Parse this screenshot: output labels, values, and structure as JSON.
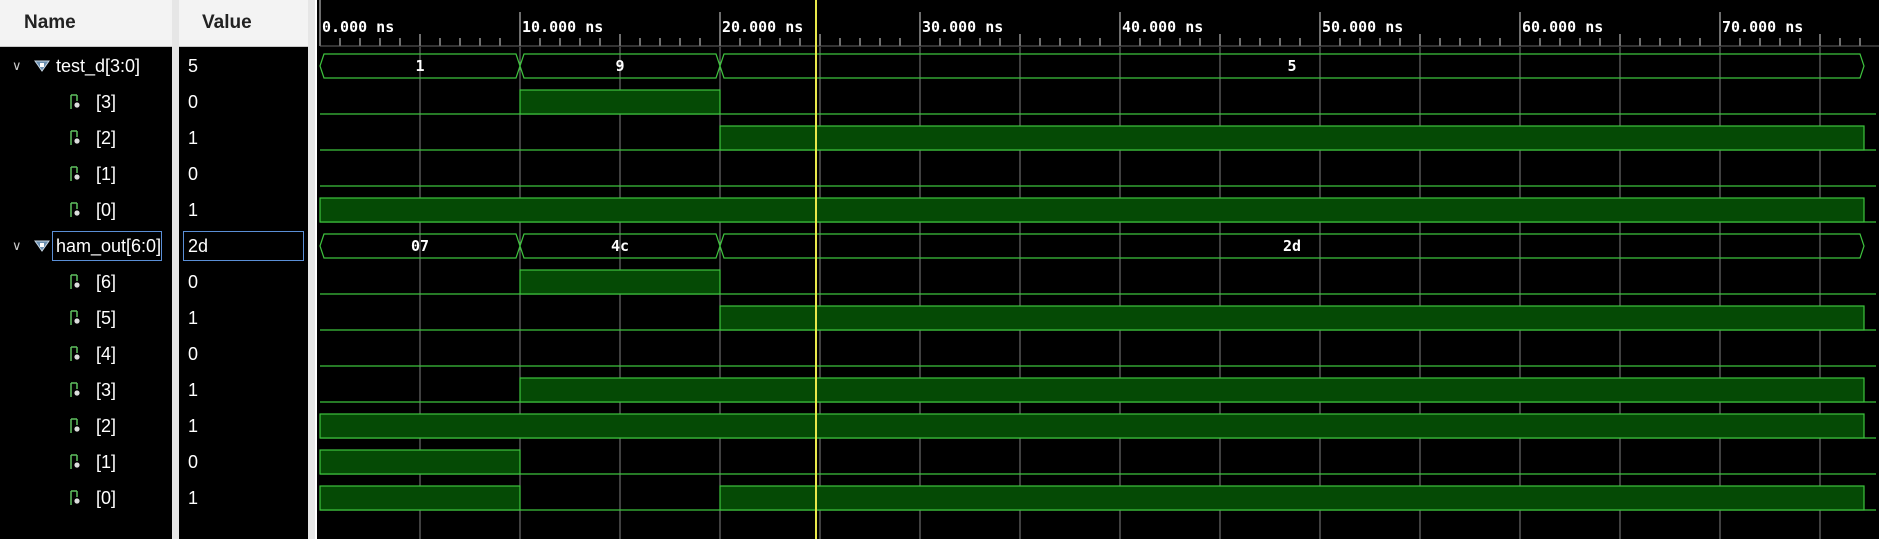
{
  "header": {
    "name_label": "Name",
    "value_label": "Value"
  },
  "timeline": {
    "start_ns": 0,
    "end_ns": 77.2,
    "unit": " ns",
    "tick_labels": [
      "0.000 ns",
      "10.000 ns",
      "20.000 ns",
      "30.000 ns",
      "40.000 ns",
      "50.000 ns",
      "60.000 ns",
      "70.000 ns"
    ],
    "cursor_ns": 24.8
  },
  "colors": {
    "high_fill": "#054a05",
    "line": "#3ec43e",
    "cursor": "#e8e84a",
    "grid": "#a0a0a0"
  },
  "signals": [
    {
      "kind": "bus",
      "name": "test_d[3:0]",
      "value": "5",
      "segments": [
        {
          "t0": 0,
          "t1": 10,
          "label": "1"
        },
        {
          "t0": 10,
          "t1": 20,
          "label": "9"
        },
        {
          "t0": 20,
          "t1": 77.2,
          "label": "5"
        }
      ]
    },
    {
      "kind": "bit",
      "name": "[3]",
      "value": "0",
      "high": [
        [
          10,
          20
        ]
      ]
    },
    {
      "kind": "bit",
      "name": "[2]",
      "value": "1",
      "high": [
        [
          20,
          77.2
        ]
      ]
    },
    {
      "kind": "bit",
      "name": "[1]",
      "value": "0",
      "high": []
    },
    {
      "kind": "bit",
      "name": "[0]",
      "value": "1",
      "high": [
        [
          0,
          77.2
        ]
      ]
    },
    {
      "kind": "bus",
      "name": "ham_out[6:0]",
      "value": "2d",
      "selected": true,
      "segments": [
        {
          "t0": 0,
          "t1": 10,
          "label": "07"
        },
        {
          "t0": 10,
          "t1": 20,
          "label": "4c"
        },
        {
          "t0": 20,
          "t1": 77.2,
          "label": "2d"
        }
      ]
    },
    {
      "kind": "bit",
      "name": "[6]",
      "value": "0",
      "high": [
        [
          10,
          20
        ]
      ]
    },
    {
      "kind": "bit",
      "name": "[5]",
      "value": "1",
      "high": [
        [
          20,
          77.2
        ]
      ]
    },
    {
      "kind": "bit",
      "name": "[4]",
      "value": "0",
      "high": []
    },
    {
      "kind": "bit",
      "name": "[3]",
      "value": "1",
      "high": [
        [
          10,
          77.2
        ]
      ]
    },
    {
      "kind": "bit",
      "name": "[2]",
      "value": "1",
      "high": [
        [
          0,
          77.2
        ]
      ]
    },
    {
      "kind": "bit",
      "name": "[1]",
      "value": "0",
      "high": [
        [
          0,
          10
        ]
      ]
    },
    {
      "kind": "bit",
      "name": "[0]",
      "value": "1",
      "high": [
        [
          0,
          10
        ],
        [
          20,
          77.2
        ]
      ]
    }
  ]
}
